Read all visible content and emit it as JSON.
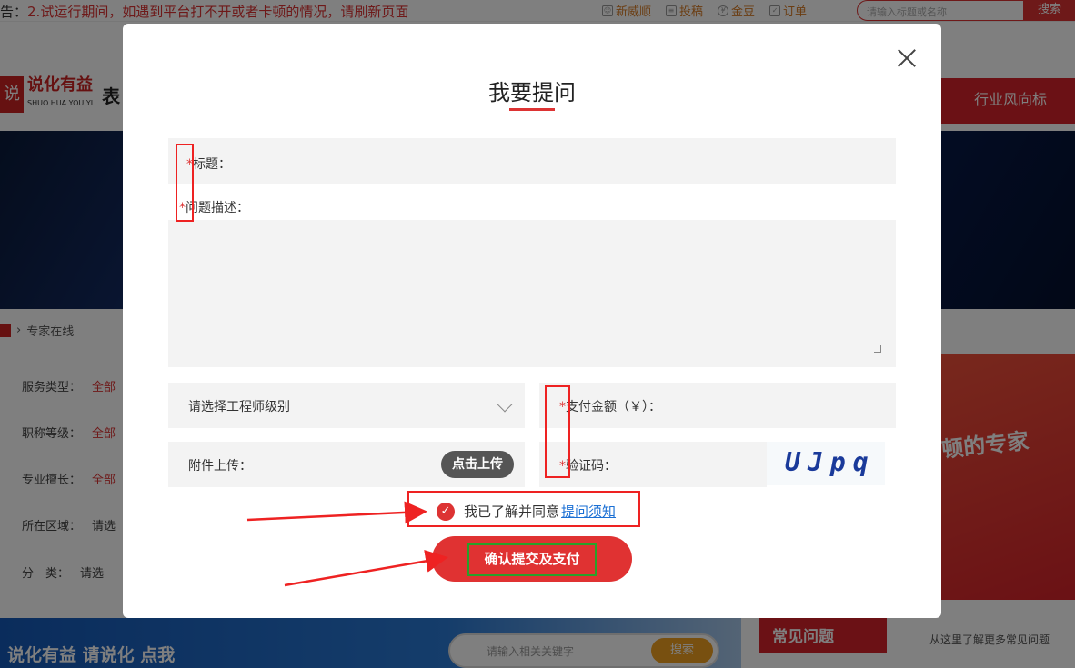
{
  "top": {
    "notice_prefix": "告：",
    "notice": "2.试运行期间，如遇到平台打不开或者卡顿的情况，请刷新页面",
    "links": [
      "新威顺",
      "投稿",
      "金豆",
      "订单"
    ],
    "search_placeholder": "请输入标题或名称",
    "search_button": "搜索"
  },
  "header": {
    "logo_cn": "说化有益",
    "logo_en": "SHUO HUA YOU YI",
    "logo_tail": "表",
    "nav_item": "行业风向标"
  },
  "breadcrumb": {
    "current": "专家在线"
  },
  "filters": [
    {
      "label": "服务类型：",
      "value": "全部"
    },
    {
      "label": "职称等级：",
      "value": "全部"
    },
    {
      "label": "专业擅长：",
      "value": "全部"
    },
    {
      "label": "所在区域：",
      "value": "请选"
    },
    {
      "label": "分　类：",
      "value": "请选"
    }
  ],
  "side_banner": {
    "text": "顿的专家"
  },
  "footer": {
    "slogan": "说化有益 请说化 点我",
    "search_placeholder": "请输入相关关键字",
    "search_button": "搜索",
    "faq_title": "常见问题",
    "faq_more": "从这里了解更多常见问题"
  },
  "modal": {
    "title": "我要提问",
    "title_label": "标题：",
    "desc_label": "问题描述：",
    "engineer_select": "请选择工程师级别",
    "amount_label": "支付金额（￥）：",
    "attach_label": "附件上传：",
    "upload_button": "点击上传",
    "captcha_label": "验证码：",
    "captcha_text": "UJpq",
    "agree_text": "我已了解并同意",
    "agree_link": "提问须知",
    "submit": "确认提交及支付"
  },
  "colors": {
    "accent": "#d6232a",
    "link": "#1a6fd4",
    "annotation": "#e22222",
    "annotation_green": "#2aa02a"
  }
}
